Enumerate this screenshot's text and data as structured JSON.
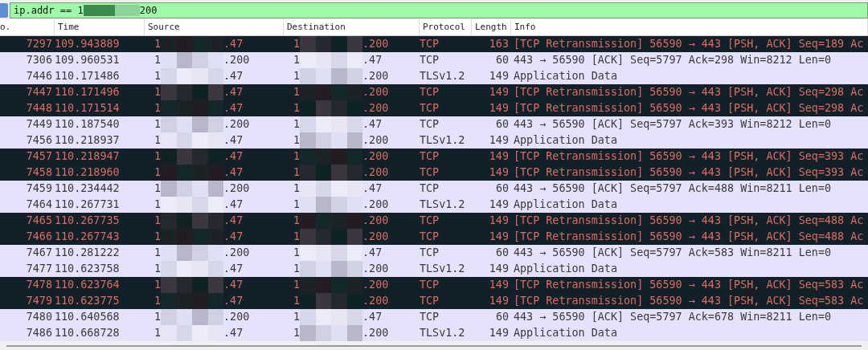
{
  "filter": {
    "text_start": "ip.addr == 1",
    "text_end": "200"
  },
  "table": {
    "columns": [
      "o.",
      "Time",
      "Source",
      "Destination",
      "Protocol",
      "Length",
      "Info"
    ],
    "rows": [
      {
        "kind": "retransmission",
        "no": "7297",
        "time": "109.943889",
        "source": {
          "start": "1",
          "end": ".47"
        },
        "destination": {
          "start": "1",
          "end": ".200"
        },
        "protocol": "TCP",
        "length": "163",
        "info": "[TCP Retransmission] 56590 → 443 [PSH, ACK] Seq=189 Ac"
      },
      {
        "kind": "normal",
        "no": "7306",
        "time": "109.960531",
        "source": {
          "start": "1",
          "end": ".200"
        },
        "destination": {
          "start": "1",
          "end": ".47"
        },
        "protocol": "TCP",
        "length": "60",
        "info": "443 → 56590 [ACK] Seq=5797 Ack=298 Win=8212 Len=0"
      },
      {
        "kind": "normal",
        "no": "7446",
        "time": "110.171486",
        "source": {
          "start": "1",
          "end": ".47"
        },
        "destination": {
          "start": "1",
          "end": ".200"
        },
        "protocol": "TLSv1.2",
        "length": "149",
        "info": "Application Data"
      },
      {
        "kind": "retransmission",
        "no": "7447",
        "time": "110.171496",
        "source": {
          "start": "1",
          "end": ".47"
        },
        "destination": {
          "start": "1",
          "end": ".200"
        },
        "protocol": "TCP",
        "length": "149",
        "info": "[TCP Retransmission] 56590 → 443 [PSH, ACK] Seq=298 Ac"
      },
      {
        "kind": "retransmission",
        "no": "7448",
        "time": "110.171514",
        "source": {
          "start": "1",
          "end": ".47"
        },
        "destination": {
          "start": "1",
          "end": ".200"
        },
        "protocol": "TCP",
        "length": "149",
        "info": "[TCP Retransmission] 56590 → 443 [PSH, ACK] Seq=298 Ac"
      },
      {
        "kind": "normal",
        "no": "7449",
        "time": "110.187540",
        "source": {
          "start": "1",
          "end": ".200"
        },
        "destination": {
          "start": "1",
          "end": ".47"
        },
        "protocol": "TCP",
        "length": "60",
        "info": "443 → 56590 [ACK] Seq=5797 Ack=393 Win=8212 Len=0"
      },
      {
        "kind": "normal",
        "no": "7456",
        "time": "110.218937",
        "source": {
          "start": "1",
          "end": ".47"
        },
        "destination": {
          "start": "1",
          "end": ".200"
        },
        "protocol": "TLSv1.2",
        "length": "149",
        "info": "Application Data"
      },
      {
        "kind": "retransmission",
        "no": "7457",
        "time": "110.218947",
        "source": {
          "start": "1",
          "end": ".47"
        },
        "destination": {
          "start": "1",
          "end": ".200"
        },
        "protocol": "TCP",
        "length": "149",
        "info": "[TCP Retransmission] 56590 → 443 [PSH, ACK] Seq=393 Ac"
      },
      {
        "kind": "retransmission",
        "no": "7458",
        "time": "110.218960",
        "source": {
          "start": "1",
          "end": ".47"
        },
        "destination": {
          "start": "1",
          "end": ".200"
        },
        "protocol": "TCP",
        "length": "149",
        "info": "[TCP Retransmission] 56590 → 443 [PSH, ACK] Seq=393 Ac"
      },
      {
        "kind": "normal",
        "no": "7459",
        "time": "110.234442",
        "source": {
          "start": "1",
          "end": ".200"
        },
        "destination": {
          "start": "1",
          "end": ".47"
        },
        "protocol": "TCP",
        "length": "60",
        "info": "443 → 56590 [ACK] Seq=5797 Ack=488 Win=8211 Len=0"
      },
      {
        "kind": "normal",
        "no": "7464",
        "time": "110.267731",
        "source": {
          "start": "1",
          "end": ".47"
        },
        "destination": {
          "start": "1",
          "end": ".200"
        },
        "protocol": "TLSv1.2",
        "length": "149",
        "info": "Application Data"
      },
      {
        "kind": "retransmission",
        "no": "7465",
        "time": "110.267735",
        "source": {
          "start": "1",
          "end": ".47"
        },
        "destination": {
          "start": "1",
          "end": ".200"
        },
        "protocol": "TCP",
        "length": "149",
        "info": "[TCP Retransmission] 56590 → 443 [PSH, ACK] Seq=488 Ac"
      },
      {
        "kind": "retransmission",
        "no": "7466",
        "time": "110.267743",
        "source": {
          "start": "1",
          "end": ".47"
        },
        "destination": {
          "start": "1",
          "end": ".200"
        },
        "protocol": "TCP",
        "length": "149",
        "info": "[TCP Retransmission] 56590 → 443 [PSH, ACK] Seq=488 Ac"
      },
      {
        "kind": "normal",
        "no": "7467",
        "time": "110.281222",
        "source": {
          "start": "1",
          "end": ".200"
        },
        "destination": {
          "start": "1",
          "end": ".47"
        },
        "protocol": "TCP",
        "length": "60",
        "info": "443 → 56590 [ACK] Seq=5797 Ack=583 Win=8211 Len=0"
      },
      {
        "kind": "normal",
        "no": "7477",
        "time": "110.623758",
        "source": {
          "start": "1",
          "end": ".47"
        },
        "destination": {
          "start": "1",
          "end": ".200"
        },
        "protocol": "TLSv1.2",
        "length": "149",
        "info": "Application Data"
      },
      {
        "kind": "retransmission",
        "no": "7478",
        "time": "110.623764",
        "source": {
          "start": "1",
          "end": ".47"
        },
        "destination": {
          "start": "1",
          "end": ".200"
        },
        "protocol": "TCP",
        "length": "149",
        "info": "[TCP Retransmission] 56590 → 443 [PSH, ACK] Seq=583 Ac"
      },
      {
        "kind": "retransmission",
        "no": "7479",
        "time": "110.623775",
        "source": {
          "start": "1",
          "end": ".47"
        },
        "destination": {
          "start": "1",
          "end": ".200"
        },
        "protocol": "TCP",
        "length": "149",
        "info": "[TCP Retransmission] 56590 → 443 [PSH, ACK] Seq=583 Ac"
      },
      {
        "kind": "normal",
        "no": "7480",
        "time": "110.640568",
        "source": {
          "start": "1",
          "end": ".200"
        },
        "destination": {
          "start": "1",
          "end": ".47"
        },
        "protocol": "TCP",
        "length": "60",
        "info": "443 → 56590 [ACK] Seq=5797 Ack=678 Win=8211 Len=0"
      },
      {
        "kind": "normal",
        "no": "7486",
        "time": "110.668728",
        "source": {
          "start": "1",
          "end": ".47"
        },
        "destination": {
          "start": "1",
          "end": ".200"
        },
        "protocol": "TLSv1.2",
        "length": "149",
        "info": "Application Data"
      }
    ]
  }
}
